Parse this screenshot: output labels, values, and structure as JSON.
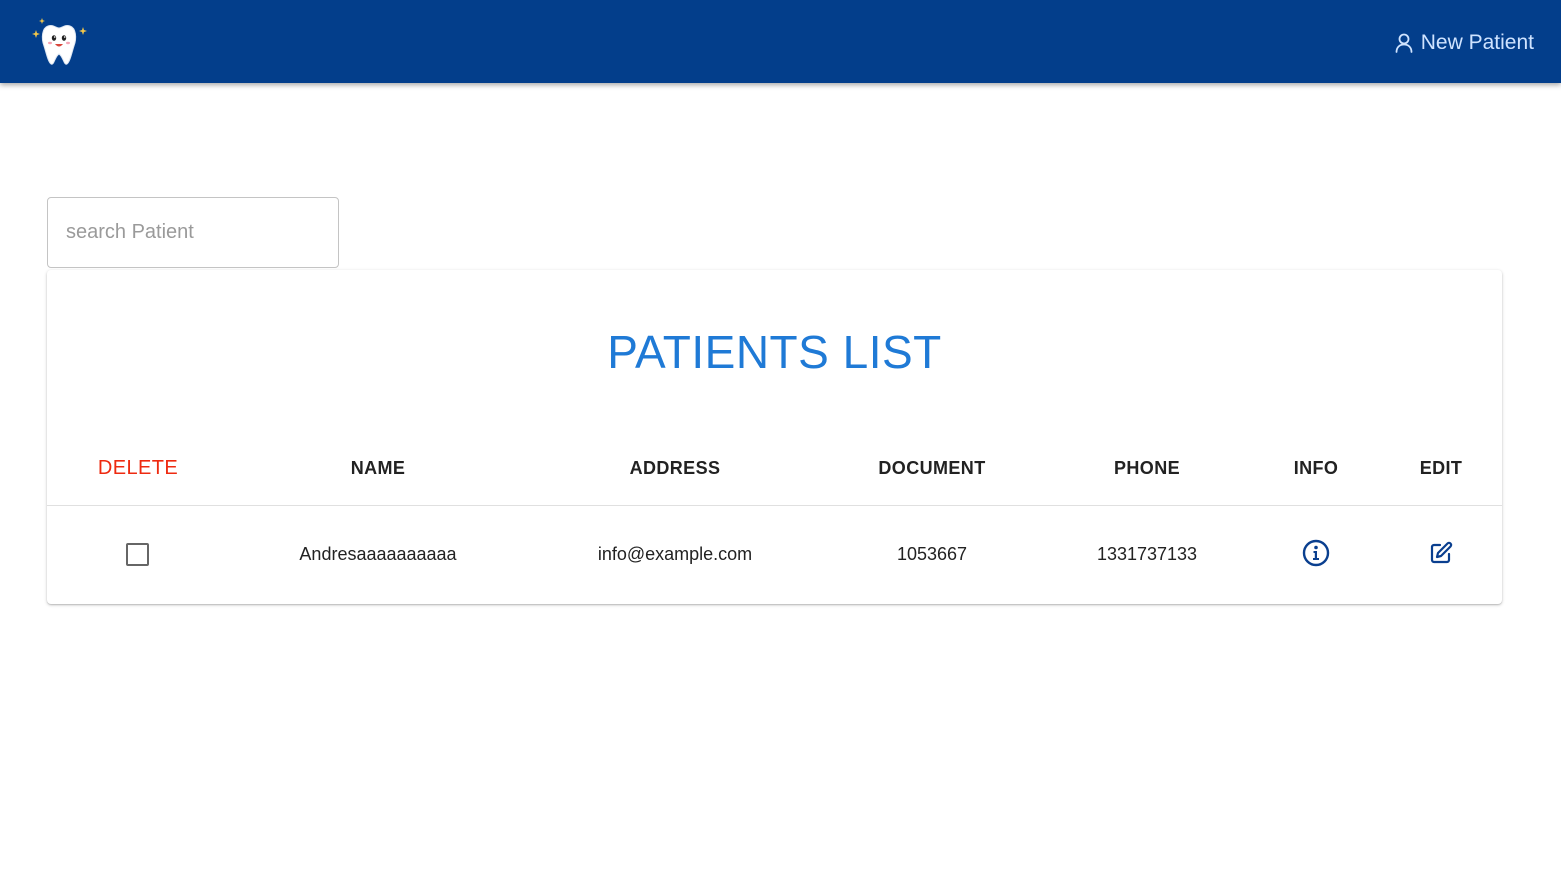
{
  "appbar": {
    "logo_icon": "tooth-logo-icon",
    "new_patient_label": "New Patient",
    "new_patient_icon": "user-icon",
    "background": "#033e8b"
  },
  "search": {
    "placeholder": "search Patient",
    "value": ""
  },
  "patients_table": {
    "title": "PATIENTS LIST",
    "columns": {
      "delete": "DELETE",
      "name": "NAME",
      "address": "ADDRESS",
      "document": "DOCUMENT",
      "phone": "PHONE",
      "info": "INFO",
      "edit": "EDIT"
    },
    "rows": [
      {
        "checked": false,
        "name": "Andresaaaaaaaaaa",
        "address": "info@example.com",
        "document": "1053667",
        "phone": "1331737133",
        "info_icon": "info-icon",
        "edit_icon": "edit-icon"
      }
    ]
  },
  "colors": {
    "title": "#1f7ad6",
    "delete_header": "#ee2a10",
    "icon": "#0a3f8f"
  }
}
